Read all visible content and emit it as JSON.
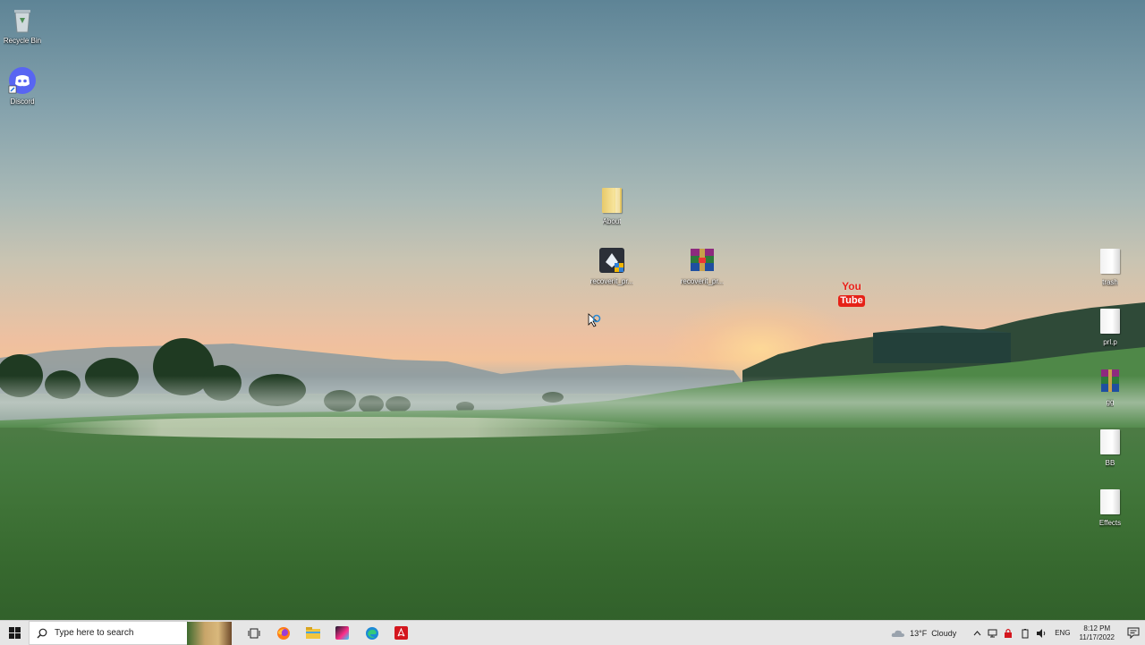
{
  "desktop": {
    "icons": [
      {
        "label": "Recycle Bin",
        "icon": "recycle-bin-icon"
      },
      {
        "label": "Discord",
        "icon": "discord-icon"
      },
      {
        "label": "About",
        "icon": "folder-icon"
      },
      {
        "label": "recoverit_pr...",
        "icon": "recoverit-installer-icon"
      },
      {
        "label": "recoverit_pr...",
        "icon": "winrar-archive-icon"
      },
      {
        "label": "You Tube",
        "icon": "youtube-icon"
      },
      {
        "label": "trash",
        "icon": "file-icon"
      },
      {
        "label": "prl.p",
        "icon": "file-icon"
      },
      {
        "label": "gg",
        "icon": "winrar-archive-icon"
      },
      {
        "label": "BB",
        "icon": "file-icon"
      },
      {
        "label": "Effects",
        "icon": "file-icon"
      }
    ],
    "youtube_text": {
      "top": "You",
      "bottom": "Tube"
    }
  },
  "taskbar": {
    "search_placeholder": "Type here to search",
    "apps": [
      "task-view-icon",
      "firefox-icon",
      "file-explorer-icon",
      "app-icon",
      "edge-icon",
      "adobe-acrobat-icon"
    ],
    "weather": {
      "temp": "13°F",
      "condition": "Cloudy"
    },
    "language": "ENG",
    "time": "8:12 PM",
    "date": "11/17/2022"
  },
  "colors": {
    "taskbar_bg": "#e6e6e6",
    "discord": "#5865f2",
    "youtube": "#e62117",
    "acrobat": "#d4161e",
    "edge": "#1c8ad6"
  }
}
